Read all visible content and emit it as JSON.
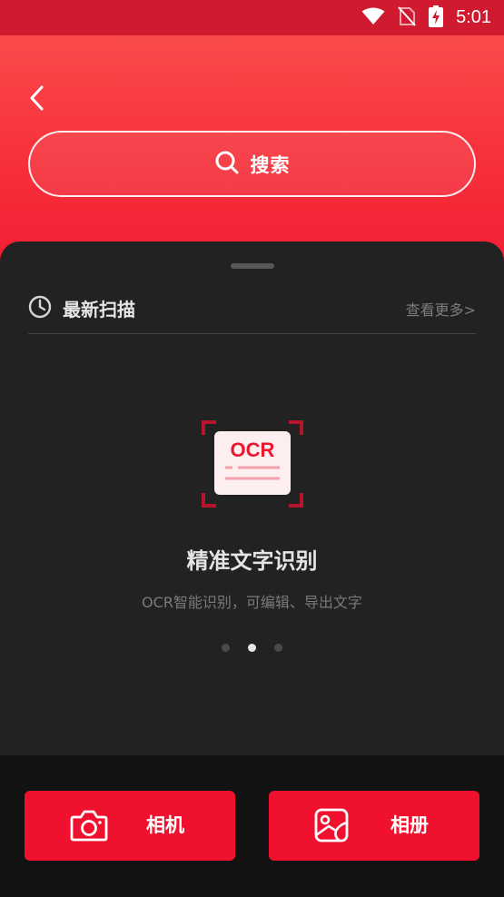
{
  "status_bar": {
    "time": "5:01"
  },
  "header": {
    "search_label": "搜索"
  },
  "recent": {
    "title": "最新扫描",
    "view_more": "查看更多>"
  },
  "feature": {
    "badge_text": "OCR",
    "title": "精准文字识别",
    "subtitle": "OCR智能识别，可编辑、导出文字"
  },
  "pager": {
    "count": 3,
    "active_index": 1
  },
  "actions": {
    "camera_label": "相机",
    "album_label": "相册"
  },
  "colors": {
    "accent": "#f0112f",
    "header_top": "#fa4a4c",
    "status_bar": "#d01a30",
    "sheet": "#222222"
  }
}
